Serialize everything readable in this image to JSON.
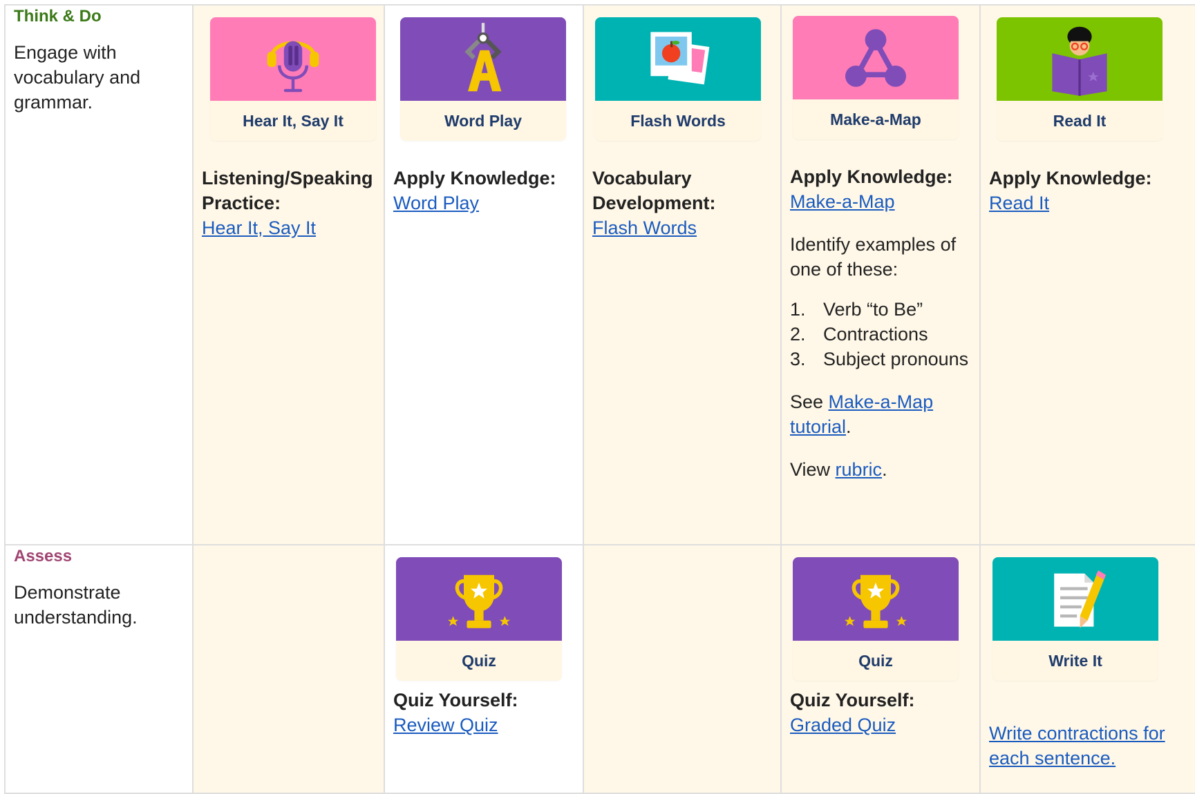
{
  "colors": {
    "pink": "#ff7cb7",
    "purple": "#7f4cb8",
    "teal": "#00b3b3",
    "green": "#7dc400",
    "cream": "#fff8e8",
    "link": "#1a5bbf",
    "label_navy": "#1f3c6b",
    "think_green": "#3b7a18",
    "assess_pink": "#a14573"
  },
  "rows": [
    {
      "title": "Think & Do",
      "description": "Engage with vocabulary and grammar."
    },
    {
      "title": "Assess",
      "description": "Demonstrate understanding."
    }
  ],
  "think": {
    "hear": {
      "card_label": "Hear It, Say It",
      "icon": "microphone-headphones-icon",
      "heading": "Listening/Speaking Practice:",
      "link": "Hear It, Say It"
    },
    "wordplay": {
      "card_label": "Word Play",
      "icon": "letter-a-crane-icon",
      "heading": "Apply Knowledge:",
      "link": "Word Play"
    },
    "flash": {
      "card_label": "Flash Words",
      "icon": "photo-cards-apple-icon",
      "heading": "Vocabulary Development:",
      "link": "Flash Words"
    },
    "map": {
      "card_label": "Make-a-Map",
      "icon": "network-map-icon",
      "heading": "Apply Knowledge:",
      "link": "Make-a-Map",
      "instructions": "Identify examples of one of these:",
      "list": [
        {
          "num": "1.",
          "text": "Verb “to Be”"
        },
        {
          "num": "2.",
          "text": "Contractions"
        },
        {
          "num": "3.",
          "text": "Subject pronouns"
        }
      ],
      "see_prefix": "See ",
      "tutorial_link": "Make-a-Map tutorial",
      "see_suffix": ".",
      "view_prefix": "View ",
      "rubric_link": "rubric",
      "view_suffix": "."
    },
    "read": {
      "card_label": "Read It",
      "icon": "child-reading-book-icon",
      "heading": "Apply Knowledge:",
      "link": "Read It"
    }
  },
  "assess": {
    "quiz1": {
      "card_label": "Quiz",
      "icon": "trophy-icon",
      "heading": "Quiz Yourself:",
      "link": "Review Quiz"
    },
    "quiz2": {
      "card_label": "Quiz",
      "icon": "trophy-icon",
      "heading": "Quiz Yourself:",
      "link": "Graded Quiz"
    },
    "write": {
      "card_label": "Write It",
      "icon": "paper-pencil-icon",
      "link": "Write contractions for each sentence."
    }
  }
}
